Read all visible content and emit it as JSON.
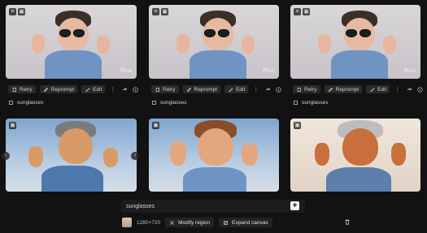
{
  "toolbar": {
    "retry_label": "Retry",
    "reprompt_label": "Reprompt",
    "edit_label": "Edit"
  },
  "prompts": {
    "top_0": "sunglasses",
    "top_1": "sunglasses",
    "top_2": "sunglasses"
  },
  "watermarks": {
    "top_0": "Pica",
    "top_1": "Pica",
    "top_2": "Pica"
  },
  "composer": {
    "value": "sunglasses"
  },
  "bottom": {
    "resolution": "1280×720",
    "modify_region_label": "Modify region",
    "expand_canvas_label": "Expand canvas"
  },
  "colors": {
    "background": "#121212",
    "toolbar_button": "#2a2a2a",
    "composer_bg": "#1c1c1c",
    "add_button_bg": "#f2f2f2"
  }
}
